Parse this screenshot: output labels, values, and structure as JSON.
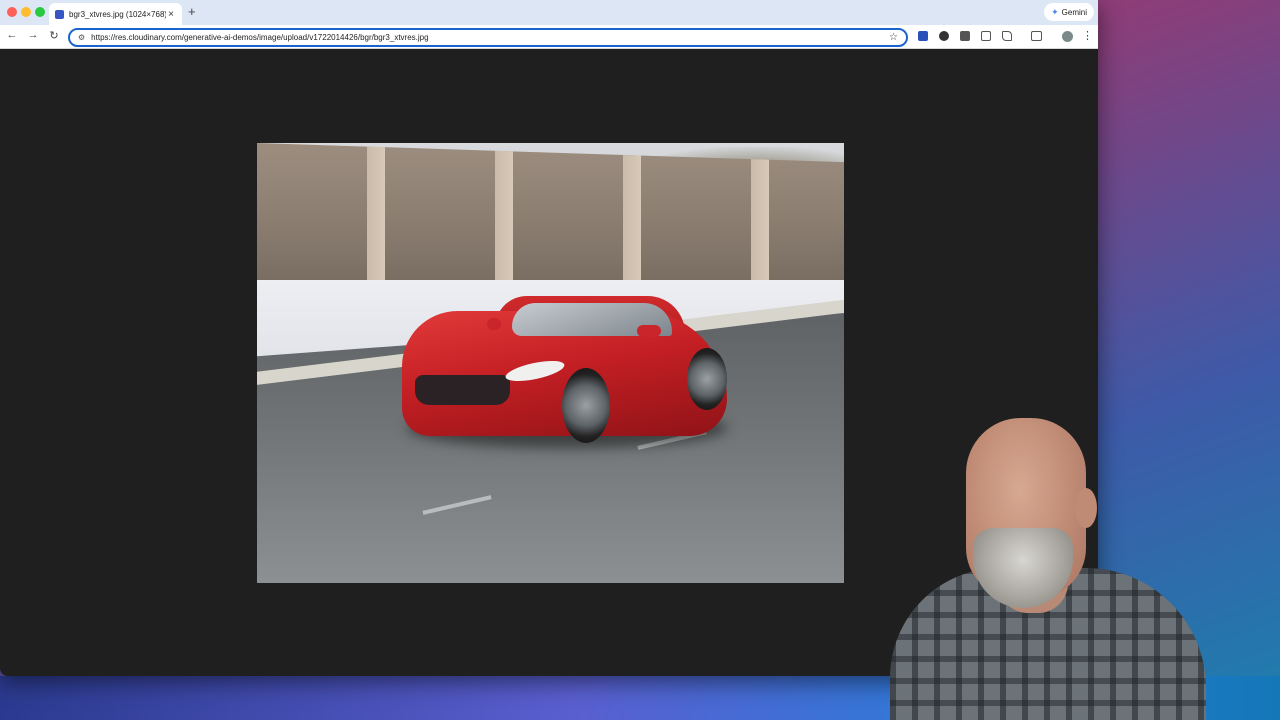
{
  "browser": {
    "tab": {
      "title": "bgr3_xtvres.jpg (1024×768)",
      "close_glyph": "×",
      "favicon": "image-favicon"
    },
    "new_tab_glyph": "+",
    "gemini_label": "Gemini",
    "gemini_glyph": "✦",
    "nav": {
      "back_glyph": "←",
      "forward_glyph": "→",
      "reload_glyph": "↻"
    },
    "address": {
      "url": "https://res.cloudinary.com/generative-ai-demos/image/upload/v1722014426/bgr/bgr3_xtvres.jpg",
      "site_info_glyph": "⚙",
      "bookmark_glyph": "☆"
    },
    "menu_glyph": "⋮",
    "extensions": [
      "extension-1-icon",
      "extension-2-icon",
      "extension-3-icon",
      "screenshot-icon",
      "puzzle-extensions-icon"
    ]
  },
  "colors": {
    "accent": "#1a64d0",
    "tabstrip": "#dde6f4",
    "viewport_bg": "#1f1f1f",
    "car_red": "#c41f24"
  },
  "content": {
    "image_subject": "red sports car on highway"
  }
}
